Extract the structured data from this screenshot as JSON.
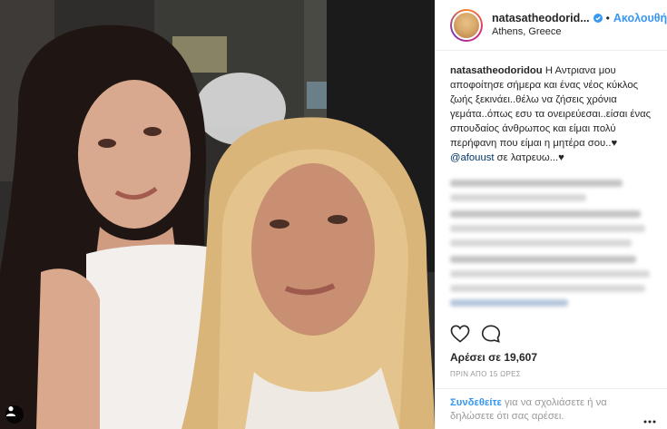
{
  "post": {
    "username": "natasatheodorid...",
    "follow_label": "Ακολουθήστε",
    "location": "Athens, Greece",
    "caption_username": "natasatheodoridou",
    "caption_text": "Η Αντριανα μου αποφοίτησε σήμερα και ένας νέος κύκλος ζωής ξεκινάει..θέλω να ζήσεις χρόνια γεμάτα..όπως εσυ τα ονειρεύεσαι..είσαι ένας σπουδαίος άνθρωπος και είμαι πολύ περήφανη που είμαι η μητέρα σου..♥",
    "caption_mention": "@afouust",
    "caption_tail": " σε λατρευω...♥",
    "likes_text": "Αρέσει σε 19,607",
    "time_text": "ΠΡΙΝ ΑΠΟ 15 ΩΡΕΣ",
    "login_link": "Συνδεθείτε",
    "login_prompt": " για να σχολιάσετε ή να δηλώσετε ότι σας αρέσει."
  },
  "icons": {
    "verified": "verified-badge-icon",
    "like": "heart-icon",
    "comment": "comment-bubble-icon",
    "user_tag": "person-icon",
    "more": "ellipsis-icon"
  },
  "colors": {
    "link_blue": "#3897f0",
    "text": "#262626",
    "muted": "#999999",
    "border": "#efefef"
  }
}
